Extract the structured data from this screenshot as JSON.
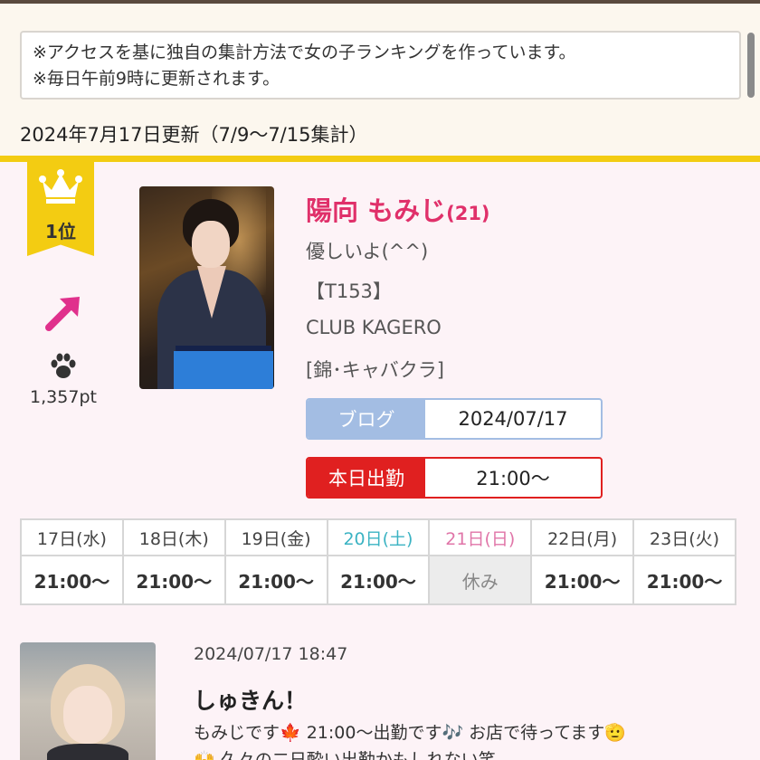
{
  "header": {
    "notice_line1": "※アクセスを基に独自の集計方法で女の子ランキングを作っています。",
    "notice_line2": "※毎日午前9時に更新されます。",
    "updated": "2024年7月17日更新（7/9〜7/15集計）"
  },
  "ranking": {
    "rank": "1位",
    "trend_icon": "arrow-up-right-icon",
    "points": "1,357pt",
    "name": "陽向 もみじ",
    "age": "(21)",
    "catchphrase": "優しいよ(^^)",
    "height": "【T153】",
    "shop": "CLUB KAGERO",
    "category": "[錦･キャバクラ]",
    "blog_label": "ブログ",
    "blog_date": "2024/07/17",
    "today_label": "本日出勤",
    "today_time": "21:00〜"
  },
  "schedule": [
    {
      "day": "17日(水)",
      "time": "21:00〜"
    },
    {
      "day": "18日(木)",
      "time": "21:00〜"
    },
    {
      "day": "19日(金)",
      "time": "21:00〜"
    },
    {
      "day": "20日(土)",
      "time": "21:00〜"
    },
    {
      "day": "21日(日)",
      "time": "休み"
    },
    {
      "day": "22日(月)",
      "time": "21:00〜"
    },
    {
      "day": "23日(火)",
      "time": "21:00〜"
    }
  ],
  "post": {
    "datetime": "2024/07/17 18:47",
    "title": "しゅきん！",
    "body_line1": "もみじです🍁 21:00〜出勤です🎶 お店で待ってます🫡",
    "body_line2": "🙌 久々の二日酔い出勤かもしれない笑"
  },
  "colors": {
    "accent_gold": "#f3cc12",
    "name_pink": "#e0306a",
    "blog_blue": "#a3bde3",
    "today_red": "#e02020",
    "saturday": "#3bb3c3",
    "sunday": "#e075a8"
  }
}
